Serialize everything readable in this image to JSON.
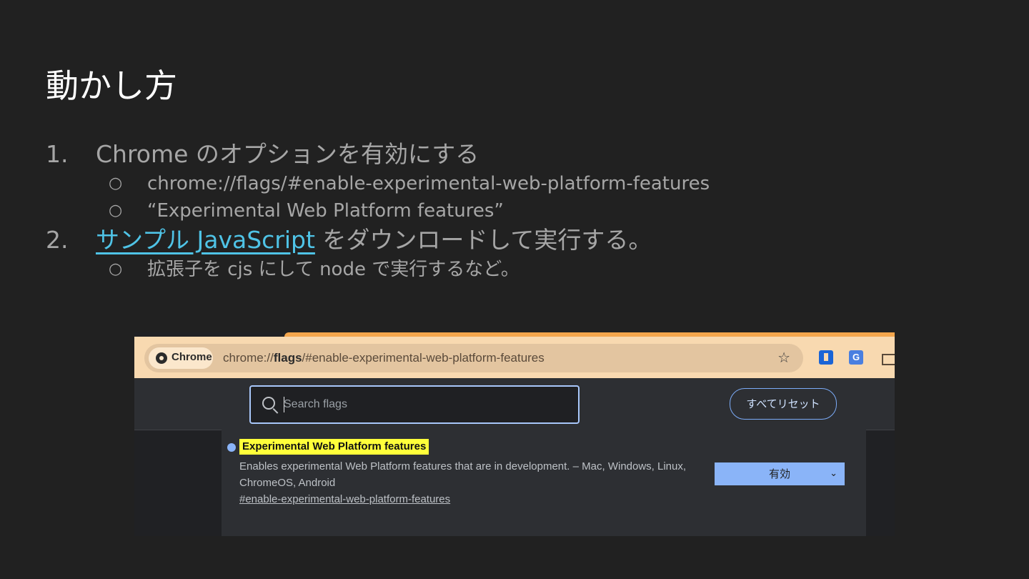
{
  "slide": {
    "title": "動かし方",
    "steps": [
      {
        "number": "1.",
        "text": "Chrome のオプションを有効にする",
        "subitems": [
          {
            "bullet": "○",
            "text": "chrome://flags/#enable-experimental-web-platform-features"
          },
          {
            "bullet": "○",
            "text": "“Experimental Web Platform features”"
          }
        ]
      },
      {
        "number": "2.",
        "link_text": "サンプル JavaScript",
        "text": " をダウンロードして実行する。",
        "subitems": [
          {
            "bullet": "○",
            "text": "拡張子を cjs にして node で実行するなど。"
          }
        ]
      }
    ]
  },
  "screenshot": {
    "chip_label": "Chrome",
    "url_prefix": "chrome://",
    "url_host": "flags",
    "url_rest": "/#enable-experimental-web-platform-features",
    "star_icon": "☆",
    "ext_translate_label": "G",
    "search_placeholder": "Search flags",
    "reset_label": "すべてリセット",
    "flag": {
      "name": "Experimental Web Platform features",
      "description": "Enables experimental Web Platform features that are in development. – Mac, Windows, Linux, ChromeOS, Android",
      "anchor": "#enable-experimental-web-platform-features",
      "selected_value": "有効",
      "chevron": "⌄"
    },
    "colors": {
      "accent_highlight": "#ffff3a",
      "select_bg": "#8ab4f8",
      "link": "#4fc3e6"
    }
  }
}
